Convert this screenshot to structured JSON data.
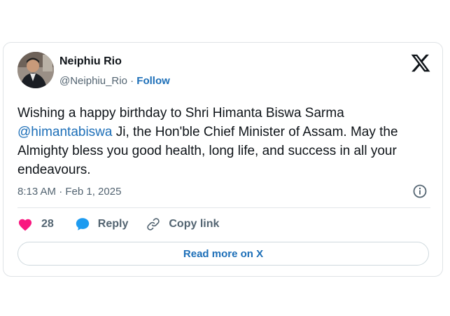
{
  "author": {
    "name": "Neiphiu Rio",
    "handle": "@Neiphiu_Rio",
    "separator": "·",
    "follow_label": "Follow"
  },
  "tweet": {
    "text_part1": "Wishing a happy birthday to Shri Himanta Biswa Sarma ",
    "mention": "@himantabiswa",
    "text_part2": " Ji, the Hon'ble Chief Minister of Assam. May the Almighty bless you good health, long life, and success in all your endeavours.",
    "timestamp": "8:13 AM · Feb 1, 2025"
  },
  "actions": {
    "like_count": "28",
    "reply_label": "Reply",
    "copy_link_label": "Copy link"
  },
  "read_more_label": "Read more on X",
  "icons": {
    "brand": "x-logo-icon",
    "info": "info-icon",
    "like": "heart-icon",
    "reply": "speech-bubble-icon",
    "copy": "link-icon"
  },
  "colors": {
    "link_blue": "#1d6fb8",
    "like_pink": "#f91880",
    "reply_blue": "#1d9bf0",
    "text_primary": "#0f1419",
    "text_secondary": "#536471",
    "border": "#cfd9de"
  }
}
